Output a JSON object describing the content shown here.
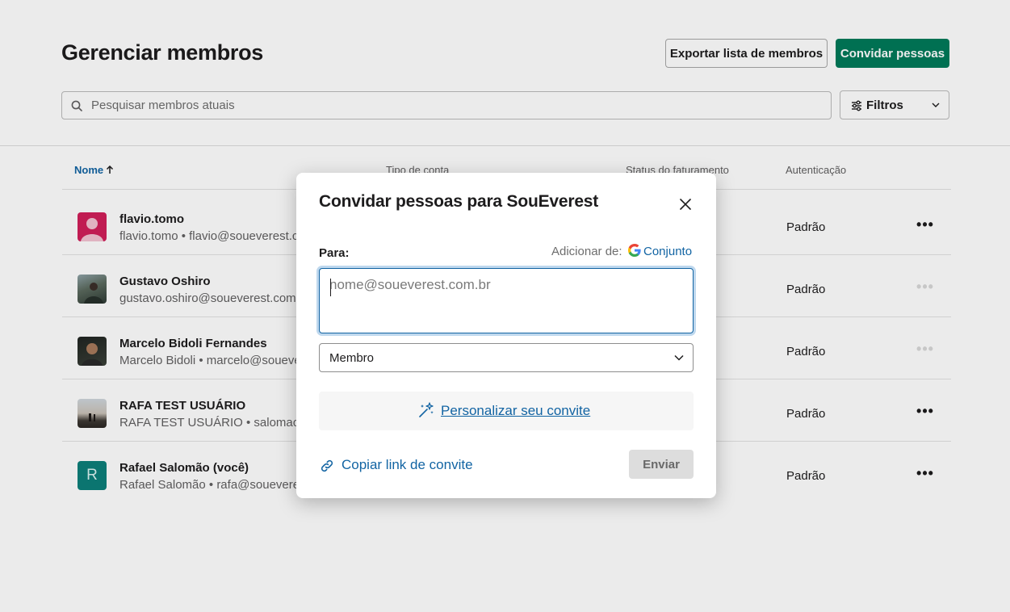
{
  "page": {
    "title": "Gerenciar membros",
    "export_label": "Exportar lista de membros",
    "invite_label": "Convidar pessoas",
    "search_placeholder": "Pesquisar membros atuais",
    "filters_label": "Filtros"
  },
  "table": {
    "headers": {
      "name": "Nome",
      "account_type": "Tipo de conta",
      "billing_status": "Status do faturamento",
      "auth": "Autenticação"
    },
    "rows": [
      {
        "name": "flavio.tomo",
        "sub": "flavio.tomo • flavio@soueverest.c",
        "auth": "Padrão"
      },
      {
        "name": "Gustavo Oshiro",
        "sub": "gustavo.oshiro@soueverest.com.b",
        "auth": "Padrão"
      },
      {
        "name": "Marcelo Bidoli Fernandes",
        "sub": "Marcelo Bidoli • marcelo@souever",
        "auth": "Padrão"
      },
      {
        "name": "RAFA TEST USUÁRIO",
        "sub": "RAFA TEST USUÁRIO • salomao.r",
        "auth": "Padrão"
      },
      {
        "name": "Rafael Salomão (você)",
        "sub": "Rafael Salomão • rafa@soueverest",
        "auth": "Padrão",
        "avatar_letter": "R"
      }
    ]
  },
  "modal": {
    "title": "Convidar pessoas para SouEverest",
    "to_label": "Para:",
    "add_from_label": "Adicionar de:",
    "google_link": "Conjunto",
    "email_placeholder": "nome@soueverest.com.br",
    "role_value": "Membro",
    "customize_label": "Personalizar seu convite",
    "copy_link_label": "Copiar link de convite",
    "send_label": "Enviar"
  },
  "colors": {
    "primary_green": "#007a5a",
    "link_blue": "#1264a3",
    "avatar_teal": "#0d7f7a",
    "avatar_red": "#d11f5a"
  },
  "icons": {
    "search": "search-icon",
    "filters": "sliders-icon",
    "close": "close-icon",
    "google": "google-icon",
    "sparkle": "sparkle-wand-icon",
    "link": "link-icon",
    "chevron": "chevron-down-icon",
    "sort": "arrow-up-icon",
    "more": "more-horizontal-icon"
  }
}
